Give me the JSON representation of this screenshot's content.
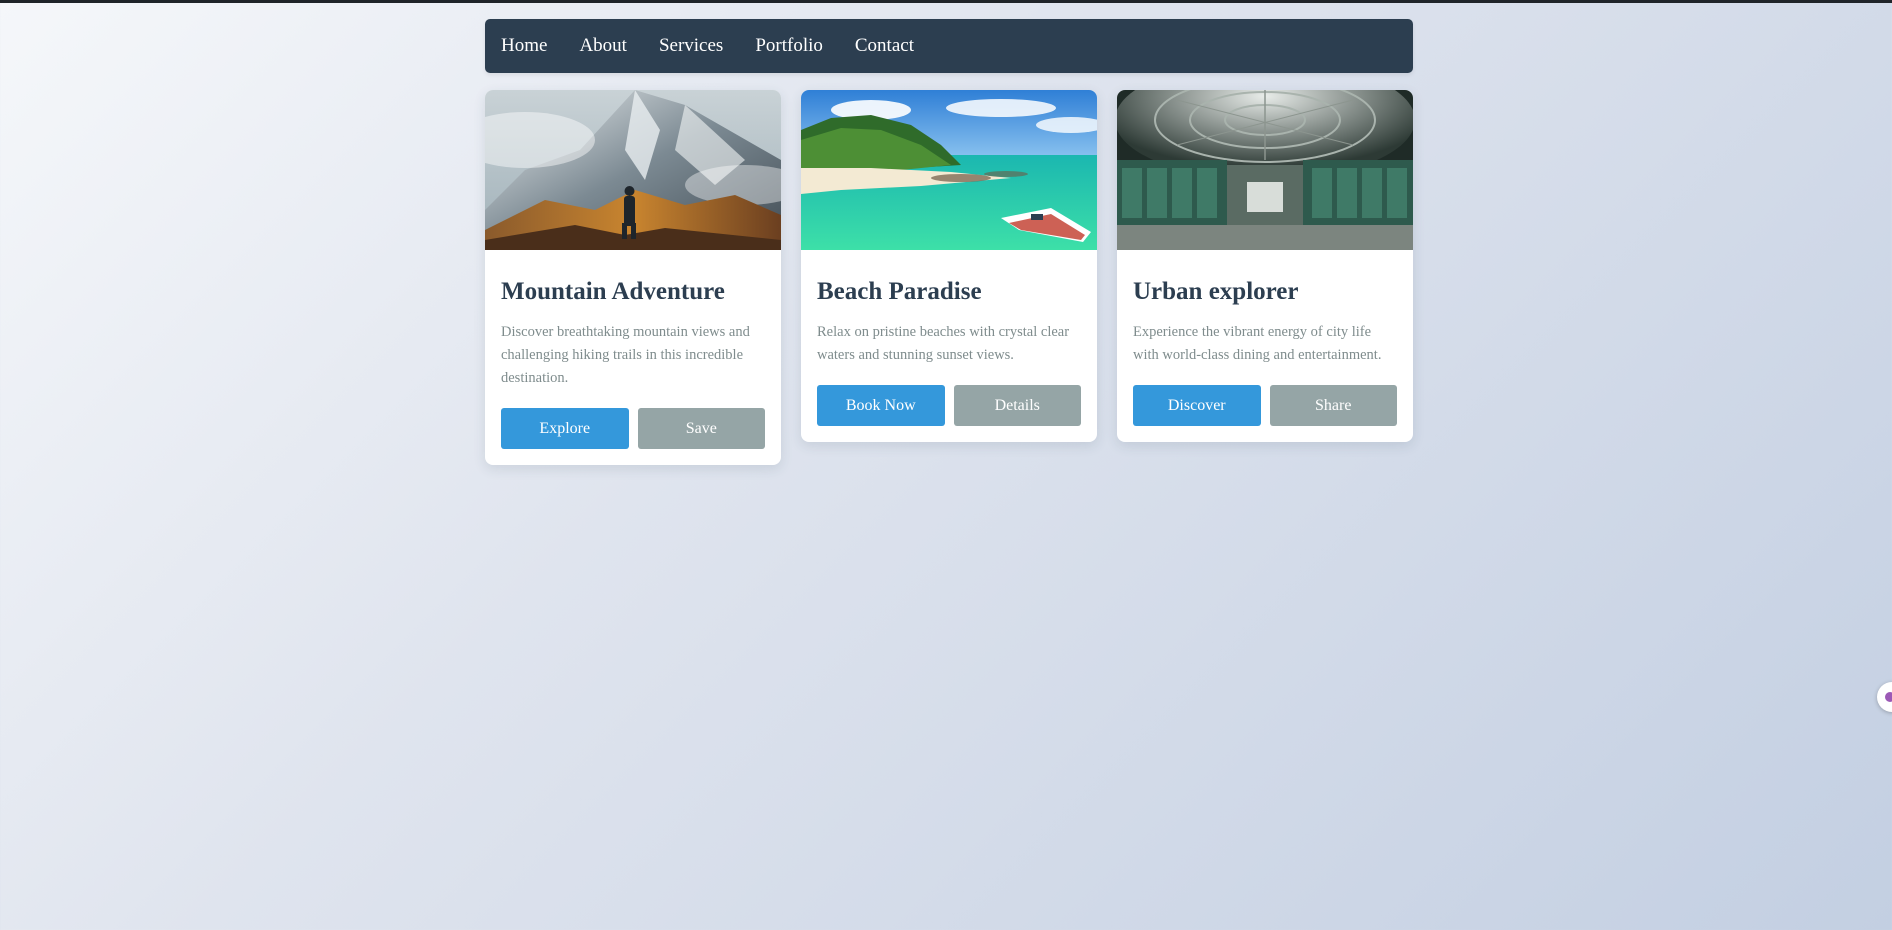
{
  "nav": {
    "items": [
      "Home",
      "About",
      "Services",
      "Portfolio",
      "Contact"
    ]
  },
  "cards": [
    {
      "image": "mountain-hiker-photo",
      "title": "Mountain Adventure",
      "description": "Discover breathtaking mountain views and challenging hiking trails in this incredible destination.",
      "primary_label": "Explore",
      "secondary_label": "Save"
    },
    {
      "image": "tropical-beach-photo",
      "title": "Beach Paradise",
      "description": "Relax on pristine beaches with crystal clear waters and stunning sunset views.",
      "primary_label": "Book Now",
      "secondary_label": "Details"
    },
    {
      "image": "domed-control-room-photo",
      "title": "Urban explorer",
      "description": "Experience the vibrant energy of city life with world-class dining and entertainment.",
      "primary_label": "Discover",
      "secondary_label": "Share"
    }
  ],
  "colors": {
    "nav_bg": "#2c3e50",
    "title": "#2c3e50",
    "text": "#7f8c8d",
    "primary": "#3498db",
    "secondary": "#95a5a6"
  },
  "widget": {
    "icon": "floating-assistant-icon"
  }
}
